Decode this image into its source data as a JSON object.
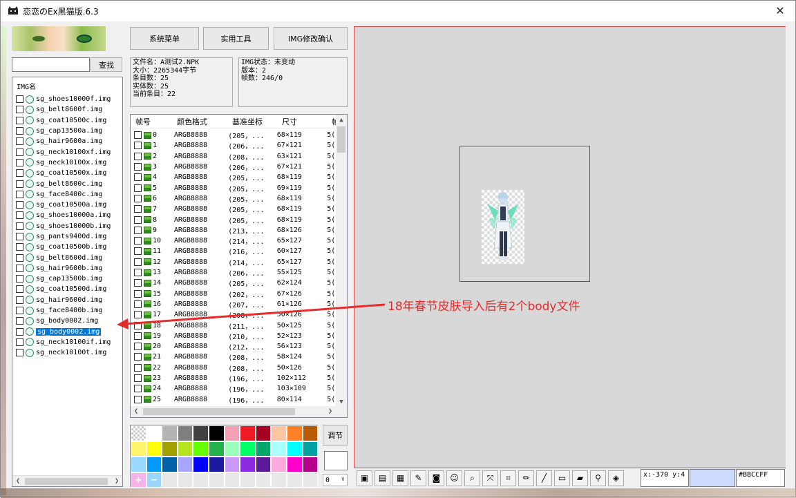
{
  "window": {
    "title": "恋恋のEx黑猫版.6.3",
    "close_glyph": "✕"
  },
  "menu": {
    "system": "系统菜单",
    "tools": "实用工具",
    "img_confirm": "IMG修改确认"
  },
  "search": {
    "value": "",
    "button": "查找"
  },
  "img_list": {
    "header": "IMG名",
    "items": [
      "sg_shoes10000f.img",
      "sg_belt8600f.img",
      "sg_coat10500c.img",
      "sg_cap13500a.img",
      "sg_hair9600a.img",
      "sg_neck10100xf.img",
      "sg_neck10100x.img",
      "sg_coat10500x.img",
      "sg_belt8600c.img",
      "sg_face8400c.img",
      "sg_coat10500a.img",
      "sg_shoes10000a.img",
      "sg_shoes10000b.img",
      "sg_pants9400d.img",
      "sg_coat10500b.img",
      "sg_belt8600d.img",
      "sg_hair9600b.img",
      "sg_cap13500b.img",
      "sg_coat10500d.img",
      "sg_hair9600d.img",
      "sg_face8400b.img",
      "sg_body0002.img",
      "sg_body0002.img",
      "sg_neck10100if.img",
      "sg_neck10100t.img"
    ],
    "selected_index": 22
  },
  "file_info": {
    "filename": "文件名：A测试2.NPK",
    "size": "大小：2265344字节",
    "entries": "条目数：25",
    "entities": "实体数：25",
    "current": "当前条目：22"
  },
  "img_info": {
    "status": "IMG状态：未变动",
    "version": "版本：2",
    "frames": "帧数：246/0"
  },
  "frame_table": {
    "columns": [
      "帧号",
      "颜色格式",
      "基准坐标",
      "尺寸",
      "帧"
    ],
    "rows": [
      [
        "0",
        "ARGB8888",
        "(205，...",
        "68×119",
        "5("
      ],
      [
        "1",
        "ARGB8888",
        "(206，...",
        "67×121",
        "5("
      ],
      [
        "2",
        "ARGB8888",
        "(208，...",
        "63×121",
        "5("
      ],
      [
        "3",
        "ARGB8888",
        "(206，...",
        "67×121",
        "5("
      ],
      [
        "4",
        "ARGB8888",
        "(205，...",
        "68×119",
        "5("
      ],
      [
        "5",
        "ARGB8888",
        "(205，...",
        "69×119",
        "5("
      ],
      [
        "6",
        "ARGB8888",
        "(205，...",
        "68×119",
        "5("
      ],
      [
        "7",
        "ARGB8888",
        "(205，...",
        "68×119",
        "5("
      ],
      [
        "8",
        "ARGB8888",
        "(205，...",
        "68×119",
        "5("
      ],
      [
        "9",
        "ARGB8888",
        "(213，...",
        "68×126",
        "5("
      ],
      [
        "10",
        "ARGB8888",
        "(214，...",
        "65×127",
        "5("
      ],
      [
        "11",
        "ARGB8888",
        "(216，...",
        "60×127",
        "5("
      ],
      [
        "12",
        "ARGB8888",
        "(214，...",
        "65×127",
        "5("
      ],
      [
        "13",
        "ARGB8888",
        "(206，...",
        "55×125",
        "5("
      ],
      [
        "14",
        "ARGB8888",
        "(205，...",
        "62×124",
        "5("
      ],
      [
        "15",
        "ARGB8888",
        "(202，...",
        "67×126",
        "5("
      ],
      [
        "16",
        "ARGB8888",
        "(207，...",
        "61×126",
        "5("
      ],
      [
        "17",
        "ARGB8888",
        "(208，...",
        "50×126",
        "5("
      ],
      [
        "18",
        "ARGB8888",
        "(211，...",
        "50×125",
        "5("
      ],
      [
        "19",
        "ARGB8888",
        "(210，...",
        "52×123",
        "5("
      ],
      [
        "20",
        "ARGB8888",
        "(212，...",
        "56×123",
        "5("
      ],
      [
        "21",
        "ARGB8888",
        "(208，...",
        "58×124",
        "5("
      ],
      [
        "22",
        "ARGB8888",
        "(208，...",
        "50×126",
        "5("
      ],
      [
        "23",
        "ARGB8888",
        "(196，...",
        "102×112",
        "5("
      ],
      [
        "24",
        "ARGB8888",
        "(196，...",
        "103×109",
        "5("
      ],
      [
        "25",
        "ARGB8888",
        "(196，...",
        "80×114",
        "5("
      ]
    ]
  },
  "palette": {
    "colors": [
      "checker",
      "#ffffff",
      "#b4b4b4",
      "#7f7f7f",
      "#404040",
      "#000000",
      "#f3a0b4",
      "#ed1c24",
      "#a50021",
      "#ffc6a5",
      "#ff7f27",
      "#b85a00",
      "#fff56b",
      "#ffff00",
      "#a0a000",
      "#b5e61d",
      "#66ff00",
      "#22b14c",
      "#99ffbb",
      "#00ff66",
      "#00a86b",
      "#aaffff",
      "#00ffff",
      "#00a2a2",
      "#99d9ff",
      "#0099ff",
      "#0061a8",
      "#a6a6ff",
      "#0000ff",
      "#1a1aa0",
      "#cc99ff",
      "#8a2be2",
      "#5a1a9a",
      "#ffaadd",
      "#ff00cc",
      "#b4008a",
      "plus",
      "minus",
      "#e8e8e8",
      "#e8e8e8",
      "#e8e8e8",
      "#e8e8e8",
      "#e8e8e8",
      "#e8e8e8",
      "#e8e8e8",
      "#e8e8e8",
      "#e8e8e8",
      "#e8e8e8"
    ]
  },
  "adjust": {
    "label": "调节"
  },
  "zoom": {
    "value": "0"
  },
  "status": {
    "coords": "x:-370 y:4",
    "hex": "#BBCCFF"
  },
  "toolbar": {
    "tools": [
      "save-image-icon",
      "layers-icon",
      "film-icon",
      "paste-icon",
      "camera-icon",
      "pig-icon",
      "zoom-icon",
      "move-icon",
      "crop-icon",
      "pencil-icon",
      "line-icon",
      "rectangle-icon",
      "eraser-icon",
      "eyedropper-icon",
      "fill-icon"
    ]
  },
  "annotation": {
    "text": "18年春节皮肤导入后有2个body文件"
  },
  "accent": {
    "selection": "#0078d7",
    "annotation": "#e52b2b",
    "canvas_border": "#d64545"
  }
}
